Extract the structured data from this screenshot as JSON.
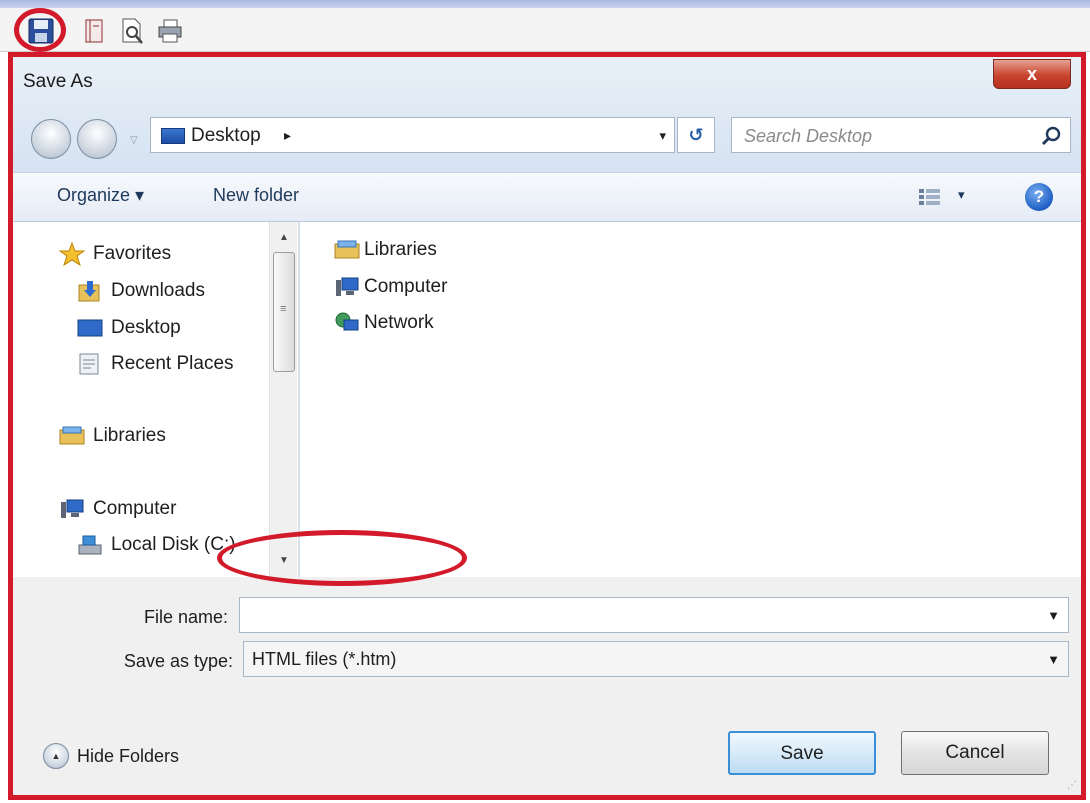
{
  "app_toolbar": {
    "icons": [
      "save-icon",
      "book-icon",
      "print-preview-icon",
      "print-icon"
    ]
  },
  "dialog": {
    "title": "Save As",
    "close_label": "x",
    "address": {
      "location": "Desktop",
      "chevron": "▸",
      "dropdown": "▾"
    },
    "search": {
      "placeholder": "Search Desktop"
    },
    "toolbar": {
      "organize": "Organize ▾",
      "new_folder": "New folder",
      "views_dropdown": "▾",
      "help": "?"
    },
    "nav_pane": {
      "items": [
        {
          "label": "Favorites",
          "icon": "star-icon"
        },
        {
          "label": "Downloads",
          "icon": "downloads-folder-icon"
        },
        {
          "label": "Desktop",
          "icon": "desktop-icon"
        },
        {
          "label": "Recent Places",
          "icon": "recent-places-icon"
        },
        {
          "label": "Libraries",
          "icon": "libraries-icon"
        },
        {
          "label": "Computer",
          "icon": "computer-icon"
        },
        {
          "label": "Local Disk (C:)",
          "icon": "local-disk-icon"
        }
      ]
    },
    "content": {
      "items": [
        {
          "label": "Libraries",
          "icon": "libraries-icon"
        },
        {
          "label": "Computer",
          "icon": "computer-icon"
        },
        {
          "label": "Network",
          "icon": "network-icon"
        }
      ]
    },
    "form": {
      "file_name_label": "File name:",
      "file_name_value": "",
      "save_as_type_label": "Save as type:",
      "save_as_type_value": "HTML files (*.htm)"
    },
    "hide_folders": "Hide Folders",
    "save_button": "Save",
    "cancel_button": "Cancel"
  },
  "colors": {
    "annotation_red": "#d21a2a",
    "dialog_frame": "#d8e4f2",
    "link_blue": "#1e395b"
  }
}
